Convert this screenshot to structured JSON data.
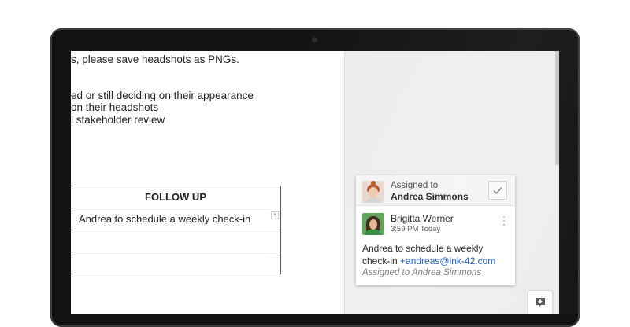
{
  "doc": {
    "lines": [
      "s, please save headshots as PNGs.",
      "ed or still deciding on their appearance",
      "on their headshots",
      "l stakeholder review"
    ],
    "table": {
      "header": "FOLLOW UP",
      "rows": [
        "Andrea to schedule a weekly check-in",
        "",
        ""
      ]
    }
  },
  "comment_card": {
    "assigned_label": "Assigned to",
    "assignee": "Andrea Simmons",
    "author": "Brigitta Werner",
    "time": "3:59 PM Today",
    "text": "Andrea to schedule a weekly check-in ",
    "mention": "+andreas@ink-42.com",
    "assigned_note": "Assigned to Andrea Simmons"
  },
  "icons": {
    "resolve": "check-icon",
    "more": "more-vert-icon",
    "add_comment": "add-comment-icon",
    "cursor": "mouse-pointer-icon"
  },
  "colors": {
    "mention": "#1a57c8",
    "pane_bg": "#eeeeee"
  }
}
